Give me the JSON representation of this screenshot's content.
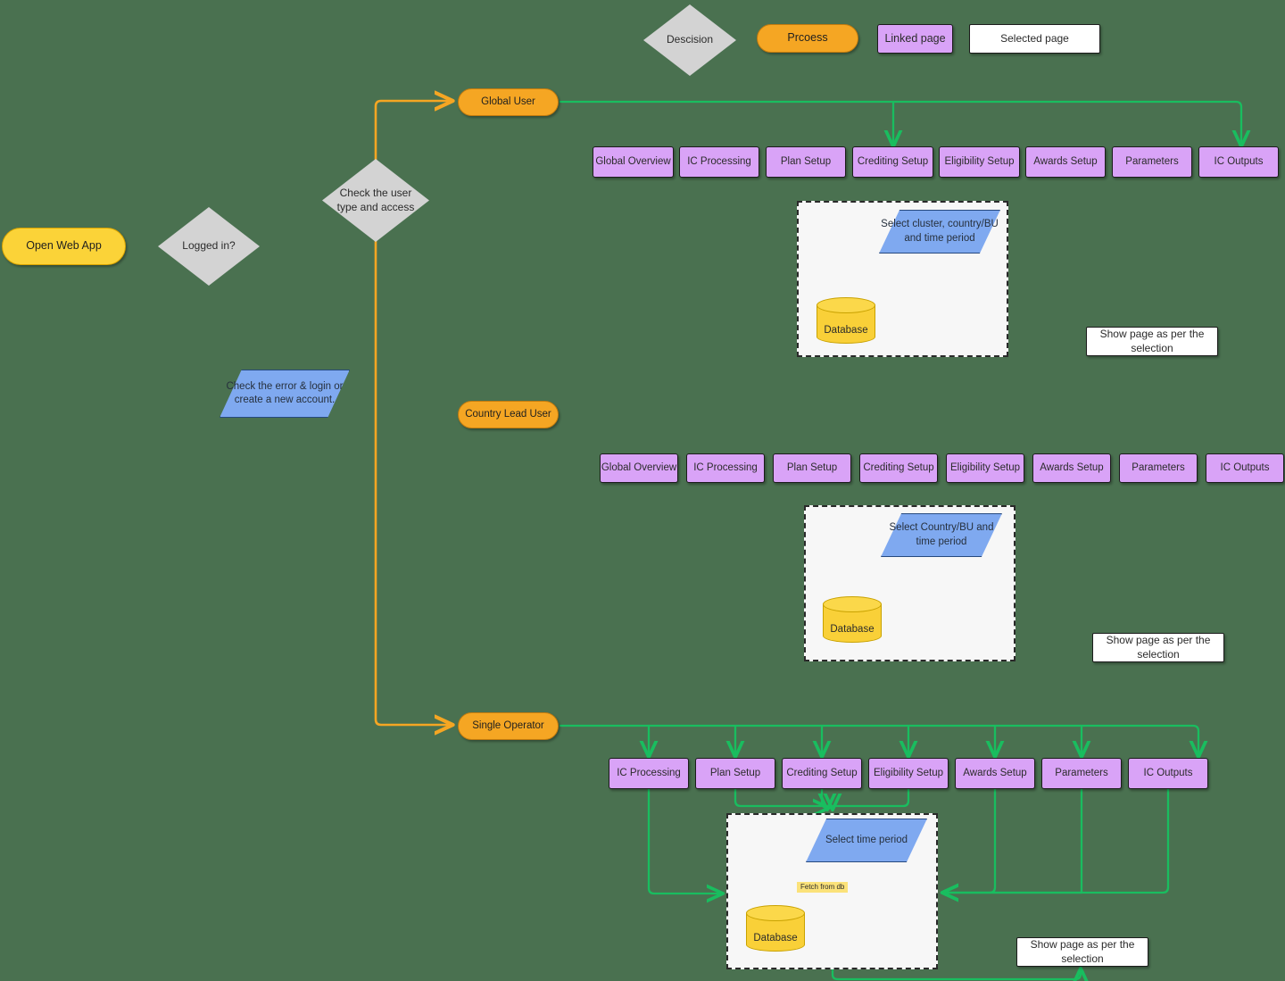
{
  "legend": {
    "decision": "Descision",
    "process": "Prcoess",
    "linked_page": "Linked page",
    "selected_page": "Selected page"
  },
  "colors": {
    "background": "#4a7150",
    "process_orange": "#f5a623",
    "terminator_yellow": "#fbd338",
    "decision_gray": "#d3d3d3",
    "linked_page_purple": "#d9a3f7",
    "selected_page_white": "#ffffff",
    "input_blue": "#7fa9f0",
    "database_yellow": "#f9d038",
    "flow_green": "#19bd5f",
    "flow_orange": "#f5a623",
    "fetch_label_yellow": "#fbe27a"
  },
  "flow": {
    "start": "Open Web App",
    "logged_in_decision": "Logged in?",
    "error_note": "Check the error & login or create a new account.",
    "user_type_decision": "Check the user type and access"
  },
  "branches": [
    {
      "id": "global-user",
      "role": "Global User",
      "pages": [
        "Global Overview",
        "IC Processing",
        "Plan Setup",
        "Crediting Setup",
        "Eligibility Setup",
        "Awards Setup",
        "Parameters",
        "IC Outputs"
      ],
      "selector": "Select cluster, country/BU and time period",
      "database": "Database",
      "output": "Show page as per the selection"
    },
    {
      "id": "country-lead-user",
      "role": "Country Lead User",
      "pages": [
        "Global Overview",
        "IC Processing",
        "Plan Setup",
        "Crediting Setup",
        "Eligibility Setup",
        "Awards Setup",
        "Parameters",
        "IC Outputs"
      ],
      "selector": "Select Country/BU and time period",
      "database": "Database",
      "output": "Show page as per the selection"
    },
    {
      "id": "single-operator",
      "role": "Single Operator",
      "pages": [
        "IC Processing",
        "Plan Setup",
        "Crediting Setup",
        "Eligibility Setup",
        "Awards Setup",
        "Parameters",
        "IC Outputs"
      ],
      "selector": "Select time period",
      "database": "Database",
      "fetch_label": "Fetch from db",
      "output": "Show page as per the selection"
    }
  ]
}
